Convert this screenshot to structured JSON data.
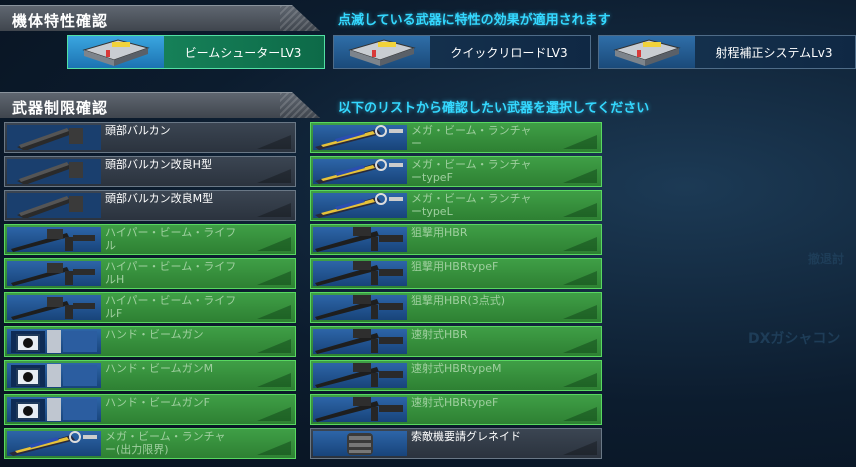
{
  "traits_section": {
    "title": "機体特性確認",
    "hint": "点滅している武器に特性の効果が適用されます",
    "traits": [
      {
        "label": "ビームシューターLV3",
        "active": true
      },
      {
        "label": "クイックリロードLV3",
        "active": false
      },
      {
        "label": "射程補正システムLv3",
        "active": false
      }
    ]
  },
  "weapons_section": {
    "title": "武器制限確認",
    "hint": "以下のリストから確認したい武器を選択してください"
  },
  "background": {
    "ghost_texts": [
      "DXガシャコン",
      "撤退討"
    ]
  },
  "weapons_left": [
    {
      "name": "頭部バルカン",
      "icon": "vulcan-cannon-icon",
      "enabled": false
    },
    {
      "name": "頭部バルカン改良H型",
      "icon": "vulcan-cannon-icon",
      "enabled": false
    },
    {
      "name": "頭部バルカン改良M型",
      "icon": "vulcan-cannon-icon",
      "enabled": false
    },
    {
      "name": "ハイパー・ビーム・ライフ\nル",
      "icon": "beam-rifle-icon",
      "enabled": true
    },
    {
      "name": "ハイパー・ビーム・ライフ\nルH",
      "icon": "beam-rifle-icon",
      "enabled": true
    },
    {
      "name": "ハイパー・ビーム・ライフ\nルF",
      "icon": "beam-rifle-icon",
      "enabled": true
    },
    {
      "name": "ハンド・ビームガン",
      "icon": "hand-beam-gun-icon",
      "enabled": true
    },
    {
      "name": "ハンド・ビームガンM",
      "icon": "hand-beam-gun-icon",
      "enabled": true
    },
    {
      "name": "ハンド・ビームガンF",
      "icon": "hand-beam-gun-icon",
      "enabled": true
    },
    {
      "name": "メガ・ビーム・ランチャ\nー(出力限界)",
      "icon": "mega-beam-launcher-icon",
      "enabled": true
    }
  ],
  "weapons_right": [
    {
      "name": "メガ・ビーム・ランチャ\nー",
      "icon": "mega-beam-launcher-icon",
      "enabled": true
    },
    {
      "name": "メガ・ビーム・ランチャ\nーtypeF",
      "icon": "mega-beam-launcher-icon",
      "enabled": true
    },
    {
      "name": "メガ・ビーム・ランチャ\nーtypeL",
      "icon": "mega-beam-launcher-icon",
      "enabled": true
    },
    {
      "name": "狙撃用HBR",
      "icon": "sniper-rifle-icon",
      "enabled": true
    },
    {
      "name": "狙撃用HBRtypeF",
      "icon": "sniper-rifle-icon",
      "enabled": true
    },
    {
      "name": "狙撃用HBR(3点式)",
      "icon": "sniper-rifle-icon",
      "enabled": true
    },
    {
      "name": "速射式HBR",
      "icon": "sniper-rifle-icon",
      "enabled": true
    },
    {
      "name": "速射式HBRtypeM",
      "icon": "sniper-rifle-icon",
      "enabled": true
    },
    {
      "name": "速射式HBRtypeF",
      "icon": "sniper-rifle-icon",
      "enabled": true
    },
    {
      "name": "索敵機要請グレネイド",
      "icon": "grenade-icon",
      "enabled": false
    }
  ]
}
